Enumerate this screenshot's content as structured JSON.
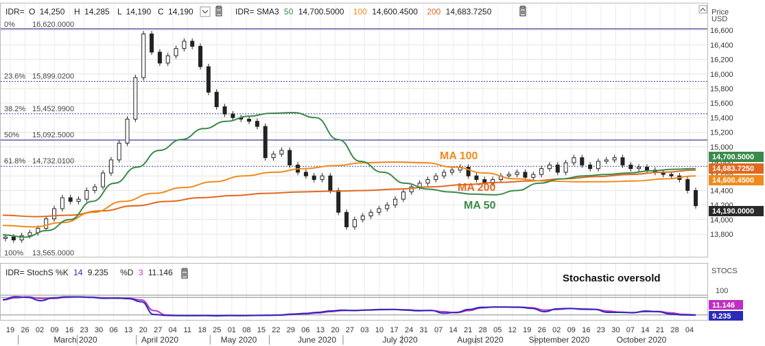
{
  "ohlc_header": {
    "symbol": "IDR=",
    "o_label": "O",
    "o_value": "14,250",
    "h_label": "H",
    "h_value": "14,285",
    "l_label": "L",
    "l_value": "14,190",
    "c_label": "C",
    "c_value": "14,190"
  },
  "sma_header": {
    "label": "IDR= SMA3",
    "p1": "50",
    "v1": "14,700.5000",
    "p2": "100",
    "v2": "14,600.4500",
    "p3": "200",
    "v3": "14,683.7250"
  },
  "price_axis": {
    "title_line1": "Price",
    "title_line2": "USD"
  },
  "stoch_header": {
    "label": "IDR= StochS %K",
    "k_period": "14",
    "k_value": "9.235",
    "d_label": "%D",
    "d_period": "3",
    "d_value": "11.146"
  },
  "stoch_axis": {
    "title": "STOCS",
    "level_label": "100"
  },
  "annotations": {
    "ma100": "MA 100",
    "ma200": "MA 200",
    "ma50": "MA 50",
    "stochastic": "Stochastic oversold"
  },
  "badges": {
    "ma50": "14,700.5000",
    "ma200": "14,683.7250",
    "ma100": "14,600.4500",
    "last": "14,190.0000",
    "stoch_d": "11.146",
    "stoch_k": "9.235"
  },
  "colors": {
    "ma50": "#3a8a4a",
    "ma100": "#f08a1c",
    "ma200": "#e06820",
    "stoch_k": "#2a2ab8",
    "stoch_d": "#c030c0",
    "fib_line": "#3a3a9a",
    "badge_dark": "#2a2a2a"
  },
  "chart_data": {
    "type": "candlestick",
    "ylim": [
      13565,
      16700
    ],
    "y_ticks": [
      13800,
      14000,
      14200,
      14400,
      14600,
      14800,
      15000,
      15200,
      15400,
      15600,
      15800,
      16000,
      16200,
      16400,
      16600
    ],
    "fib_levels": [
      {
        "pct": "0%",
        "value": 16620.0,
        "text": "16,620.0000"
      },
      {
        "pct": "23.6%",
        "value": 15899.02,
        "text": "15,899.0200"
      },
      {
        "pct": "38.2%",
        "value": 15452.99,
        "text": "15,452.9900"
      },
      {
        "pct": "50%",
        "value": 15092.5,
        "text": "15,092.5000"
      },
      {
        "pct": "61.8%",
        "value": 14732.01,
        "text": "14,732.0100"
      },
      {
        "pct": "100%",
        "value": 13565.0,
        "text": "13,565.0000"
      }
    ],
    "x_day_ticks": [
      "19",
      "26",
      "02",
      "09",
      "16",
      "23",
      "30",
      "06",
      "13",
      "20",
      "27",
      "04",
      "11",
      "18",
      "25",
      "01",
      "08",
      "15",
      "22",
      "29",
      "06",
      "13",
      "20",
      "27",
      "03",
      "10",
      "17",
      "24",
      "31",
      "07",
      "14",
      "21",
      "28",
      "05",
      "12",
      "19",
      "26",
      "02",
      "09",
      "16",
      "23",
      "30",
      "07",
      "14",
      "21",
      "28",
      "04"
    ],
    "months": [
      "March 2020",
      "April 2020",
      "May 2020",
      "June 2020",
      "July 2020",
      "August 2020",
      "September 2020",
      "October 2020"
    ],
    "close_series": [
      13760,
      13720,
      13780,
      13820,
      13880,
      14010,
      14150,
      14300,
      14250,
      14280,
      14400,
      14450,
      14640,
      14820,
      15050,
      15380,
      15950,
      16550,
      16300,
      16150,
      16250,
      16350,
      16450,
      16380,
      16100,
      15750,
      15550,
      15450,
      15400,
      15380,
      15350,
      15280,
      14850,
      14900,
      14950,
      14750,
      14650,
      14600,
      14550,
      14600,
      14400,
      14100,
      13900,
      14000,
      14050,
      14100,
      14150,
      14200,
      14280,
      14380,
      14450,
      14500,
      14550,
      14600,
      14650,
      14680,
      14720,
      14600,
      14550,
      14500,
      14550,
      14600,
      14620,
      14650,
      14580,
      14620,
      14700,
      14750,
      14650,
      14780,
      14850,
      14750,
      14700,
      14800,
      14820,
      14850,
      14750,
      14700,
      14720,
      14680,
      14650,
      14620,
      14600,
      14550,
      14400,
      14190
    ],
    "ma50": [
      13790,
      13760,
      13850,
      14000,
      14250,
      14500,
      14720,
      14950,
      15100,
      15250,
      15350,
      15420,
      15460,
      15470,
      15400,
      15100,
      14800,
      14650,
      14500,
      14420,
      14380,
      14350,
      14340,
      14400,
      14500,
      14560,
      14600,
      14620,
      14640,
      14670,
      14690,
      14700
    ],
    "ma100": [
      13920,
      13900,
      13960,
      14100,
      14250,
      14360,
      14440,
      14520,
      14600,
      14650,
      14700,
      14740,
      14780,
      14790,
      14780,
      14720,
      14640,
      14560,
      14530,
      14520,
      14520,
      14530,
      14560,
      14600
    ],
    "ma200": [
      14060,
      14040,
      14060,
      14120,
      14190,
      14250,
      14300,
      14330,
      14360,
      14380,
      14390,
      14400,
      14420,
      14450,
      14480,
      14510,
      14530,
      14560,
      14590,
      14620,
      14650,
      14680
    ],
    "series": [
      {
        "name": "%K",
        "values": [
          80,
          93,
          90,
          75,
          88,
          92,
          92,
          90,
          86,
          87,
          84,
          70,
          12,
          8,
          7,
          7,
          8,
          6,
          8,
          7,
          8,
          9,
          10,
          14,
          17,
          22,
          28,
          32,
          30,
          33,
          35,
          35,
          32,
          29,
          31,
          18,
          22,
          35,
          45,
          46,
          46,
          45,
          40,
          25,
          38,
          40,
          36,
          35,
          22,
          22,
          20,
          28,
          25,
          14,
          10,
          9.2
        ]
      },
      {
        "name": "%D",
        "values": [
          78,
          88,
          92,
          85,
          85,
          90,
          92,
          91,
          88,
          86,
          86,
          78,
          30,
          10,
          8,
          7,
          7,
          7,
          7,
          7,
          8,
          8,
          9,
          12,
          15,
          19,
          25,
          30,
          31,
          32,
          34,
          35,
          34,
          31,
          30,
          25,
          20,
          30,
          42,
          46,
          46,
          46,
          43,
          32,
          35,
          39,
          38,
          36,
          28,
          23,
          21,
          25,
          26,
          20,
          13,
          11.1
        ]
      }
    ]
  }
}
